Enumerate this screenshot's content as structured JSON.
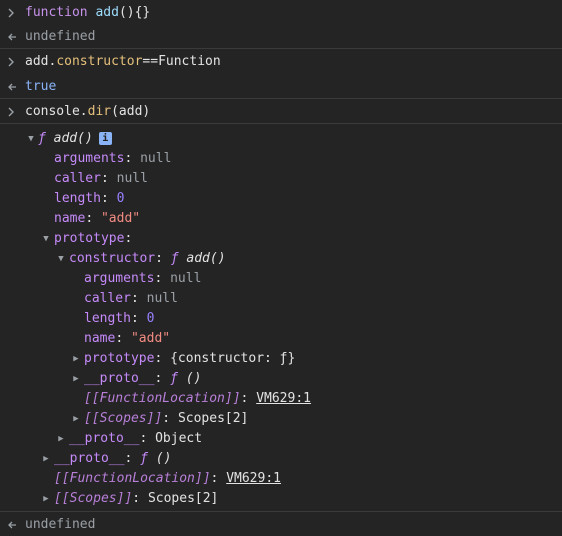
{
  "entries": [
    {
      "input": "function add(){}",
      "output": "undefined"
    },
    {
      "input": "add.constructor==Function",
      "output": "true"
    },
    {
      "input": "console.dir(add)"
    }
  ],
  "input1": {
    "keyword": "function",
    "name": "add",
    "tail": "(){}"
  },
  "input2": {
    "obj": "add",
    "dot": ".",
    "prop": "constructor",
    "op": "==",
    "rhs": "Function"
  },
  "input3": {
    "obj": "console",
    "dot": ".",
    "method": "dir",
    "args": "(add)"
  },
  "output1": "undefined",
  "output2": "true",
  "final_output": "undefined",
  "tree": {
    "root": {
      "f": "ƒ",
      "label": "add()",
      "info": "i"
    },
    "arguments": {
      "key": "arguments",
      "val": "null"
    },
    "caller": {
      "key": "caller",
      "val": "null"
    },
    "length": {
      "key": "length",
      "val": "0"
    },
    "name": {
      "key": "name",
      "val": "\"add\""
    },
    "prototype": {
      "key": "prototype"
    },
    "constructor": {
      "key": "constructor",
      "f": "ƒ",
      "label": "add()"
    },
    "c_arguments": {
      "key": "arguments",
      "val": "null"
    },
    "c_caller": {
      "key": "caller",
      "val": "null"
    },
    "c_length": {
      "key": "length",
      "val": "0"
    },
    "c_name": {
      "key": "name",
      "val": "\"add\""
    },
    "c_prototype": {
      "key": "prototype",
      "val": "{constructor: ƒ}"
    },
    "c_proto": {
      "key": "__proto__",
      "f": "ƒ",
      "val": "()"
    },
    "c_location": {
      "key": "[[FunctionLocation]]",
      "val": "VM629:1"
    },
    "c_scopes": {
      "key": "[[Scopes]]",
      "val": "Scopes[2]"
    },
    "p_proto": {
      "key": "__proto__",
      "val": "Object"
    },
    "proto": {
      "key": "__proto__",
      "f": "ƒ",
      "val": "()"
    },
    "location": {
      "key": "[[FunctionLocation]]",
      "val": "VM629:1"
    },
    "scopes": {
      "key": "[[Scopes]]",
      "val": "Scopes[2]"
    }
  },
  "colors": {
    "background": "#242424",
    "text": "#e3e3e3",
    "property": "#c58af9",
    "string": "#f28b82",
    "number": "#9980ff"
  }
}
